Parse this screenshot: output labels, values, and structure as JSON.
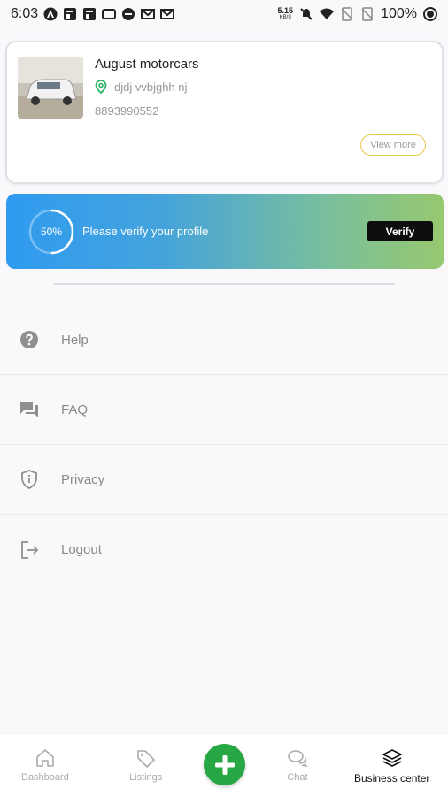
{
  "status_bar": {
    "time": "6:03",
    "net_speed": "5.15",
    "net_unit": "KB/S",
    "battery": "100%"
  },
  "business_card": {
    "name": "August motorcars",
    "location": "djdj vvbjghh nj",
    "phone": "8893990552",
    "view_more_label": "View more",
    "thumbnail_icon": "car-photo"
  },
  "verify_banner": {
    "progress": 0.5,
    "progress_label": "50%",
    "message": "Please verify your profile",
    "button_label": "Verify"
  },
  "menu": {
    "items": [
      {
        "label": "Help",
        "icon": "help-circle-icon"
      },
      {
        "label": "FAQ",
        "icon": "forum-icon"
      },
      {
        "label": "Privacy",
        "icon": "shield-info-icon"
      },
      {
        "label": "Logout",
        "icon": "logout-icon"
      }
    ]
  },
  "bottom_nav": {
    "items": [
      {
        "label": "Dashboard",
        "icon": "home-icon"
      },
      {
        "label": "Listings",
        "icon": "tag-icon"
      },
      {
        "label": "Chat",
        "icon": "chat-icon"
      },
      {
        "label": "Business center",
        "icon": "layers-icon",
        "active": true
      }
    ],
    "fab_icon": "plus-icon"
  },
  "colors": {
    "accent_green": "#28a745",
    "banner_start": "#2f9bf0",
    "banner_end": "#97c86f",
    "view_more_border": "#e6c94a"
  }
}
